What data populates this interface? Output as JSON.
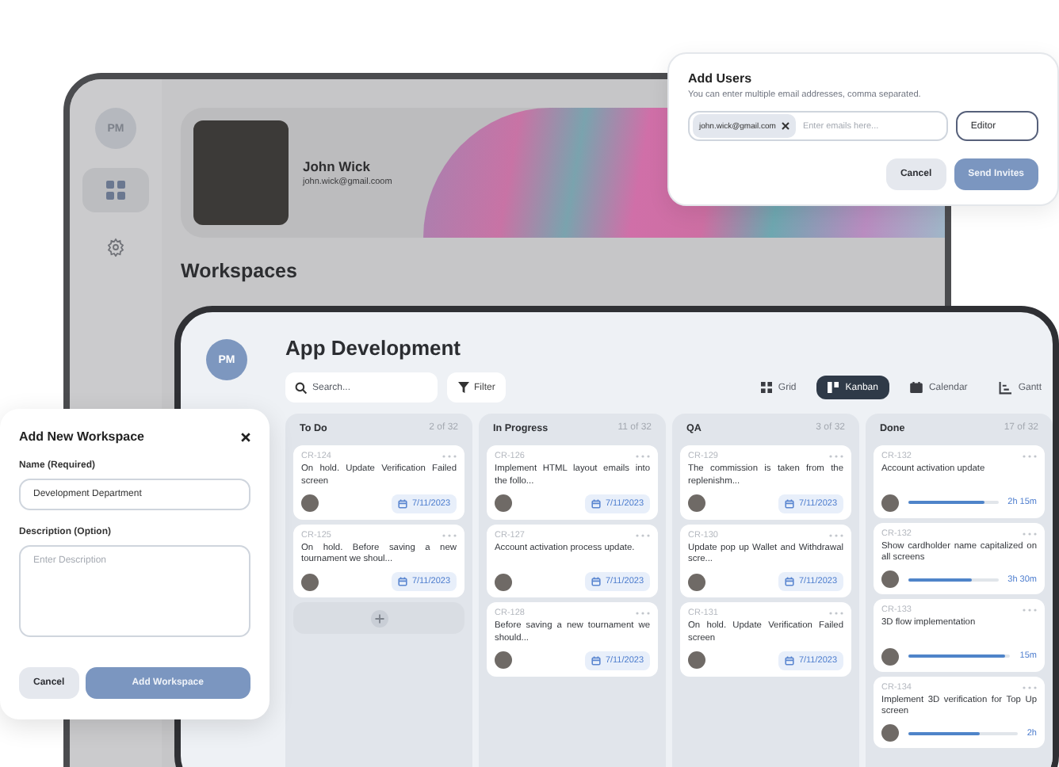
{
  "back_window": {
    "sidebar": {
      "avatar": "PM",
      "items": [
        {
          "kind": "grid",
          "selected": true
        },
        {
          "kind": "settings",
          "selected": false
        }
      ]
    },
    "profile": {
      "name": "John Wick",
      "email": "john.wick@gmail.coom"
    },
    "heading": "Workspaces"
  },
  "add_users_dialog": {
    "title": "Add Users",
    "hint": "You can enter multiple email addresses, comma separated.",
    "tags": [
      "john.wick@gmail.com"
    ],
    "placeholder": "Enter emails here...",
    "role": "Editor",
    "buttons": [
      {
        "label": "Cancel",
        "kind": "secondary"
      },
      {
        "label": "Send Invites",
        "kind": "primary"
      }
    ]
  },
  "board": {
    "avatar": "PM",
    "title": "App Development",
    "search": {
      "placeholder": "Search..."
    },
    "filter": "Filter",
    "views": [
      {
        "label": "Grid",
        "kind": "grid",
        "selected": false
      },
      {
        "label": "Kanban",
        "kind": "kanban",
        "selected": true
      },
      {
        "label": "Calendar",
        "kind": "calendar",
        "selected": false
      },
      {
        "label": "Gantt",
        "kind": "gantt",
        "selected": false
      }
    ],
    "columns": [
      {
        "title": "To Do",
        "count": "2 of 32",
        "can_add": true,
        "cards": [
          {
            "id": "CR-124",
            "text": "On hold. Update Verification Failed screen",
            "kind": "date",
            "date": "7/11/2023"
          },
          {
            "id": "CR-125",
            "text": "On hold. Before saving a new tournament we shoul...",
            "kind": "date",
            "date": "7/11/2023"
          }
        ]
      },
      {
        "title": "In Progress",
        "count": "11 of 32",
        "can_add": false,
        "cards": [
          {
            "id": "CR-126",
            "text": "Implement HTML layout emails into the follo...",
            "kind": "date",
            "date": "7/11/2023"
          },
          {
            "id": "CR-127",
            "text": "Account activation process update.",
            "kind": "date",
            "date": "7/11/2023"
          },
          {
            "id": "CR-128",
            "text": "Before saving a new tournament we should...",
            "kind": "date",
            "date": "7/11/2023"
          }
        ]
      },
      {
        "title": "QA",
        "count": "3 of 32",
        "can_add": false,
        "cards": [
          {
            "id": "CR-129",
            "text": "The commission is taken from the replenishm...",
            "kind": "date",
            "date": "7/11/2023"
          },
          {
            "id": "CR-130",
            "text": "Update pop up Wallet and Withdrawal scre...",
            "kind": "date",
            "date": "7/11/2023"
          },
          {
            "id": "CR-131",
            "text": "On hold. Update Verification Failed screen",
            "kind": "date",
            "date": "7/11/2023"
          }
        ]
      },
      {
        "title": "Done",
        "count": "17 of 32",
        "can_add": false,
        "cards": [
          {
            "id": "CR-132",
            "text": "Account activation update",
            "kind": "progress",
            "level": 0.85,
            "time": "2h 15m"
          },
          {
            "id": "CR-132",
            "text": "Show cardholder name capitalized on all screens",
            "kind": "progress",
            "level": 0.7,
            "time": "3h 30m"
          },
          {
            "id": "CR-133",
            "text": "3D flow implementation",
            "kind": "progress",
            "level": 0.95,
            "time": "15m"
          },
          {
            "id": "CR-134",
            "text": "Implement 3D verification for Top Up screen",
            "kind": "progress",
            "level": 0.65,
            "time": "2h"
          }
        ]
      }
    ]
  },
  "add_workspace_dialog": {
    "title": "Add New Workspace",
    "name_label": "Name (Required)",
    "name_value": "Development Department",
    "description_label": "Description (Option)",
    "description_placeholder": "Enter Description",
    "buttons": [
      {
        "label": "Cancel",
        "kind": "secondary"
      },
      {
        "label": "Add Workspace",
        "kind": "primary"
      }
    ]
  }
}
